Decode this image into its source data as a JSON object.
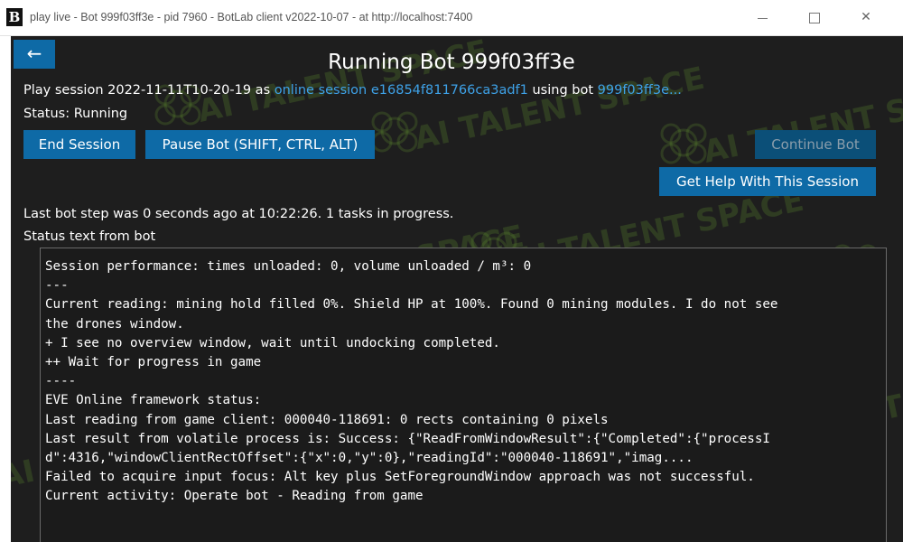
{
  "window": {
    "icon_letter": "B",
    "title": "play live - Bot 999f03ff3e - pid 7960 - BotLab client v2022-10-07 - at http://localhost:7400",
    "minimize_glyph": "—",
    "maximize_glyph": "☐",
    "close_glyph": "✕"
  },
  "header": {
    "back_glyph": "←",
    "title": "Running Bot 999f03ff3e"
  },
  "session": {
    "prefix": "Play session 2022-11-11T10-20-19 as ",
    "online_session_link": "online session e16854f811766ca3adf1",
    "middle": " using bot ",
    "bot_link": "999f03ff3e..."
  },
  "status": "Status: Running",
  "buttons": {
    "end_session": "End Session",
    "pause_bot": "Pause Bot (SHIFT, CTRL, ALT)",
    "continue_bot": "Continue Bot",
    "get_help": "Get Help With This Session"
  },
  "last_step": "Last bot step was 0 seconds ago at 10:22:26. 1 tasks in progress.",
  "status_text_label": "Status text from bot",
  "status_lines": [
    "Session performance: times unloaded: 0, volume unloaded / m³: 0",
    "---",
    "Current reading: mining hold filled 0%. Shield HP at 100%. Found 0 mining modules. I do not see",
    "the drones window.",
    "+ I see no overview window, wait until undocking completed.",
    "++ Wait for progress in game",
    "----",
    "EVE Online framework status:",
    "Last reading from game client: 000040-118691: 0 rects containing 0 pixels",
    "Last result from volatile process is: Success: {\"ReadFromWindowResult\":{\"Completed\":{\"processI",
    "d\":4316,\"windowClientRectOffset\":{\"x\":0,\"y\":0},\"readingId\":\"000040-118691\",\"imag....",
    "Failed to acquire input focus: Alt key plus SetForegroundWindow approach was not successful.",
    "Current activity: Operate bot - Reading from game"
  ],
  "watermark": {
    "text": "AI TALENT SPACE"
  },
  "colors": {
    "background": "#1e1e1e",
    "button": "#0e6aa6",
    "button_disabled": "#0b4f78",
    "link": "#3ea2e8",
    "watermark": "#5c8a2e"
  }
}
